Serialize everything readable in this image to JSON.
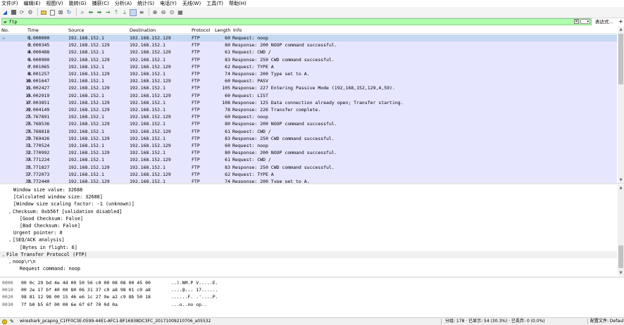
{
  "menu": [
    "文件(F)",
    "编辑(E)",
    "视图(V)",
    "跳转(G)",
    "捕获(C)",
    "分析(A)",
    "统计(S)",
    "电话(Y)",
    "无线(W)",
    "工具(T)",
    "帮助(H)"
  ],
  "toolbar_icons": [
    "shark-fin-start-icon",
    "stop-icon",
    "restart-icon",
    "options-gear-icon",
    "open-folder-icon",
    "save-icon",
    "close-file-icon",
    "reload-icon",
    "find-icon",
    "back-icon",
    "forward-icon",
    "goto-icon",
    "first-icon",
    "last-icon",
    "autoscroll-icon",
    "colorize-icon",
    "zoom-in-icon",
    "zoom-out-icon",
    "zoom-normal-icon",
    "resize-columns-icon"
  ],
  "filter": {
    "value": "ftp",
    "expression_label": "表达式…",
    "clear_glyph": "✕",
    "plus_glyph": "+"
  },
  "columns": [
    "No.",
    "Time",
    "Source",
    "Destination",
    "Protocol",
    "Length",
    "Info"
  ],
  "packets": [
    {
      "no": "1",
      "time": "0.000000",
      "src": "192.168.152.1",
      "dst": "192.168.152.129",
      "proto": "FTP",
      "len": "60",
      "info": "Request: noop",
      "selected": true
    },
    {
      "no": "2",
      "time": "0.000345",
      "src": "192.168.152.129",
      "dst": "192.168.152.1",
      "proto": "FTP",
      "len": "80",
      "info": "Response: 200 NOOP command successful."
    },
    {
      "no": "4",
      "time": "0.000488",
      "src": "192.168.152.1",
      "dst": "192.168.152.129",
      "proto": "FTP",
      "len": "61",
      "info": "Request: CWD /"
    },
    {
      "no": "5",
      "time": "0.000900",
      "src": "192.168.152.129",
      "dst": "192.168.152.1",
      "proto": "FTP",
      "len": "83",
      "info": "Response: 250 CWD command successful."
    },
    {
      "no": "7",
      "time": "0.001065",
      "src": "192.168.152.1",
      "dst": "192.168.152.129",
      "proto": "FTP",
      "len": "62",
      "info": "Request: TYPE A"
    },
    {
      "no": "8",
      "time": "0.001257",
      "src": "192.168.152.129",
      "dst": "192.168.152.1",
      "proto": "FTP",
      "len": "74",
      "info": "Response: 200 Type set to A."
    },
    {
      "no": "10",
      "time": "0.001647",
      "src": "192.168.152.1",
      "dst": "192.168.152.129",
      "proto": "FTP",
      "len": "60",
      "info": "Request: PASV"
    },
    {
      "no": "11",
      "time": "0.002427",
      "src": "192.168.152.129",
      "dst": "192.168.152.1",
      "proto": "FTP",
      "len": "105",
      "info": "Response: 227 Entering Passive Mode (192,168,152,129,4,59)."
    },
    {
      "no": "15",
      "time": "0.002919",
      "src": "192.168.152.1",
      "dst": "192.168.152.129",
      "proto": "FTP",
      "len": "60",
      "info": "Request: LIST"
    },
    {
      "no": "17",
      "time": "0.003851",
      "src": "192.168.152.129",
      "dst": "192.168.152.1",
      "proto": "FTP",
      "len": "108",
      "info": "Response: 125 Data connection already open; Transfer starting."
    },
    {
      "no": "22",
      "time": "0.004149",
      "src": "192.168.152.129",
      "dst": "192.168.152.1",
      "proto": "FTP",
      "len": "78",
      "info": "Response: 226 Transfer complete."
    },
    {
      "no": "25",
      "time": "7.767891",
      "src": "192.168.152.1",
      "dst": "192.168.152.129",
      "proto": "FTP",
      "len": "60",
      "info": "Request: noop"
    },
    {
      "no": "26",
      "time": "7.768536",
      "src": "192.168.152.129",
      "dst": "192.168.152.1",
      "proto": "FTP",
      "len": "80",
      "info": "Response: 200 NOOP command successful."
    },
    {
      "no": "28",
      "time": "7.768818",
      "src": "192.168.152.1",
      "dst": "192.168.152.129",
      "proto": "FTP",
      "len": "61",
      "info": "Request: CWD /"
    },
    {
      "no": "29",
      "time": "7.769426",
      "src": "192.168.152.129",
      "dst": "192.168.152.1",
      "proto": "FTP",
      "len": "83",
      "info": "Response: 250 CWD command successful."
    },
    {
      "no": "31",
      "time": "7.770524",
      "src": "192.168.152.1",
      "dst": "192.168.152.129",
      "proto": "FTP",
      "len": "60",
      "info": "Request: noop"
    },
    {
      "no": "32",
      "time": "7.770992",
      "src": "192.168.152.129",
      "dst": "192.168.152.1",
      "proto": "FTP",
      "len": "80",
      "info": "Response: 200 NOOP command successful."
    },
    {
      "no": "34",
      "time": "7.771224",
      "src": "192.168.152.1",
      "dst": "192.168.152.129",
      "proto": "FTP",
      "len": "61",
      "info": "Request: CWD /"
    },
    {
      "no": "35",
      "time": "7.771827",
      "src": "192.168.152.129",
      "dst": "192.168.152.1",
      "proto": "FTP",
      "len": "83",
      "info": "Response: 250 CWD command successful."
    },
    {
      "no": "37",
      "time": "7.772073",
      "src": "192.168.152.1",
      "dst": "192.168.152.129",
      "proto": "FTP",
      "len": "62",
      "info": "Request: TYPE A"
    },
    {
      "no": "38",
      "time": "7.772440",
      "src": "192.168.152.129",
      "dst": "192.168.152.1",
      "proto": "FTP",
      "len": "74",
      "info": "Response: 200 Type set to A."
    }
  ],
  "details": [
    {
      "indent": 2,
      "arrow": "",
      "text": "Window size value: 32688"
    },
    {
      "indent": 2,
      "arrow": "",
      "text": "[Calculated window size: 32688]"
    },
    {
      "indent": 2,
      "arrow": "",
      "text": "[Window size scaling factor: -1 (unknown)]"
    },
    {
      "indent": 1,
      "arrow": "⌄",
      "text": "Checksum: 0xb56f [validation disabled]"
    },
    {
      "indent": 3,
      "arrow": "",
      "text": "[Good Checksum: False]"
    },
    {
      "indent": 3,
      "arrow": "",
      "text": "[Bad Checksum: False]"
    },
    {
      "indent": 2,
      "arrow": "",
      "text": "Urgent pointer: 0"
    },
    {
      "indent": 1,
      "arrow": "⌄",
      "text": "[SEQ/ACK analysis]"
    },
    {
      "indent": 3,
      "arrow": "",
      "text": "[Bytes in flight: 6]"
    },
    {
      "indent": 0,
      "arrow": "⌄",
      "text": "File Transfer Protocol (FTP)",
      "selected": true
    },
    {
      "indent": 1,
      "arrow": "⌄",
      "text": "noop\\r\\n"
    },
    {
      "indent": 3,
      "arrow": "",
      "text": "Request command: noop"
    }
  ],
  "bytes": [
    {
      "offset": "0000",
      "hex": "00 0c 29 bd 4e 4d 00 50  56 c0 00 08 08 00 45 00",
      "ascii": "..).NM.P V.....E."
    },
    {
      "offset": "0010",
      "hex": "00 2e 17 bf 40 00 80 06  31 37 c0 a8 98 01 c0 a8",
      "ascii": "....@... 17......"
    },
    {
      "offset": "0020",
      "hex": "98 81 12 98 00 15 46 e6  1c 27 9e a2 c9 8b 50 18",
      "ascii": "......F. .'....P."
    },
    {
      "offset": "0030",
      "hex": "7f b0 b5 6f 00 00 6e 6f  6f 70 0d 0a",
      "ascii": "...o..no op.."
    }
  ],
  "status": {
    "file": "wireshark_pcapng_C1FF0C3E-0599-44E1-AFC1-BF16938DC3FC_20171009210706_a05532",
    "stats": "分组: 178 · 已显示: 54 (30.3%) · 已丢弃: 0 (0.0%)",
    "profile": "配置文件: Default"
  },
  "colors": {
    "filter_ok": "#afffaf",
    "list_bg": "#e7e6ff",
    "selected_row": "#c5d9f3"
  }
}
